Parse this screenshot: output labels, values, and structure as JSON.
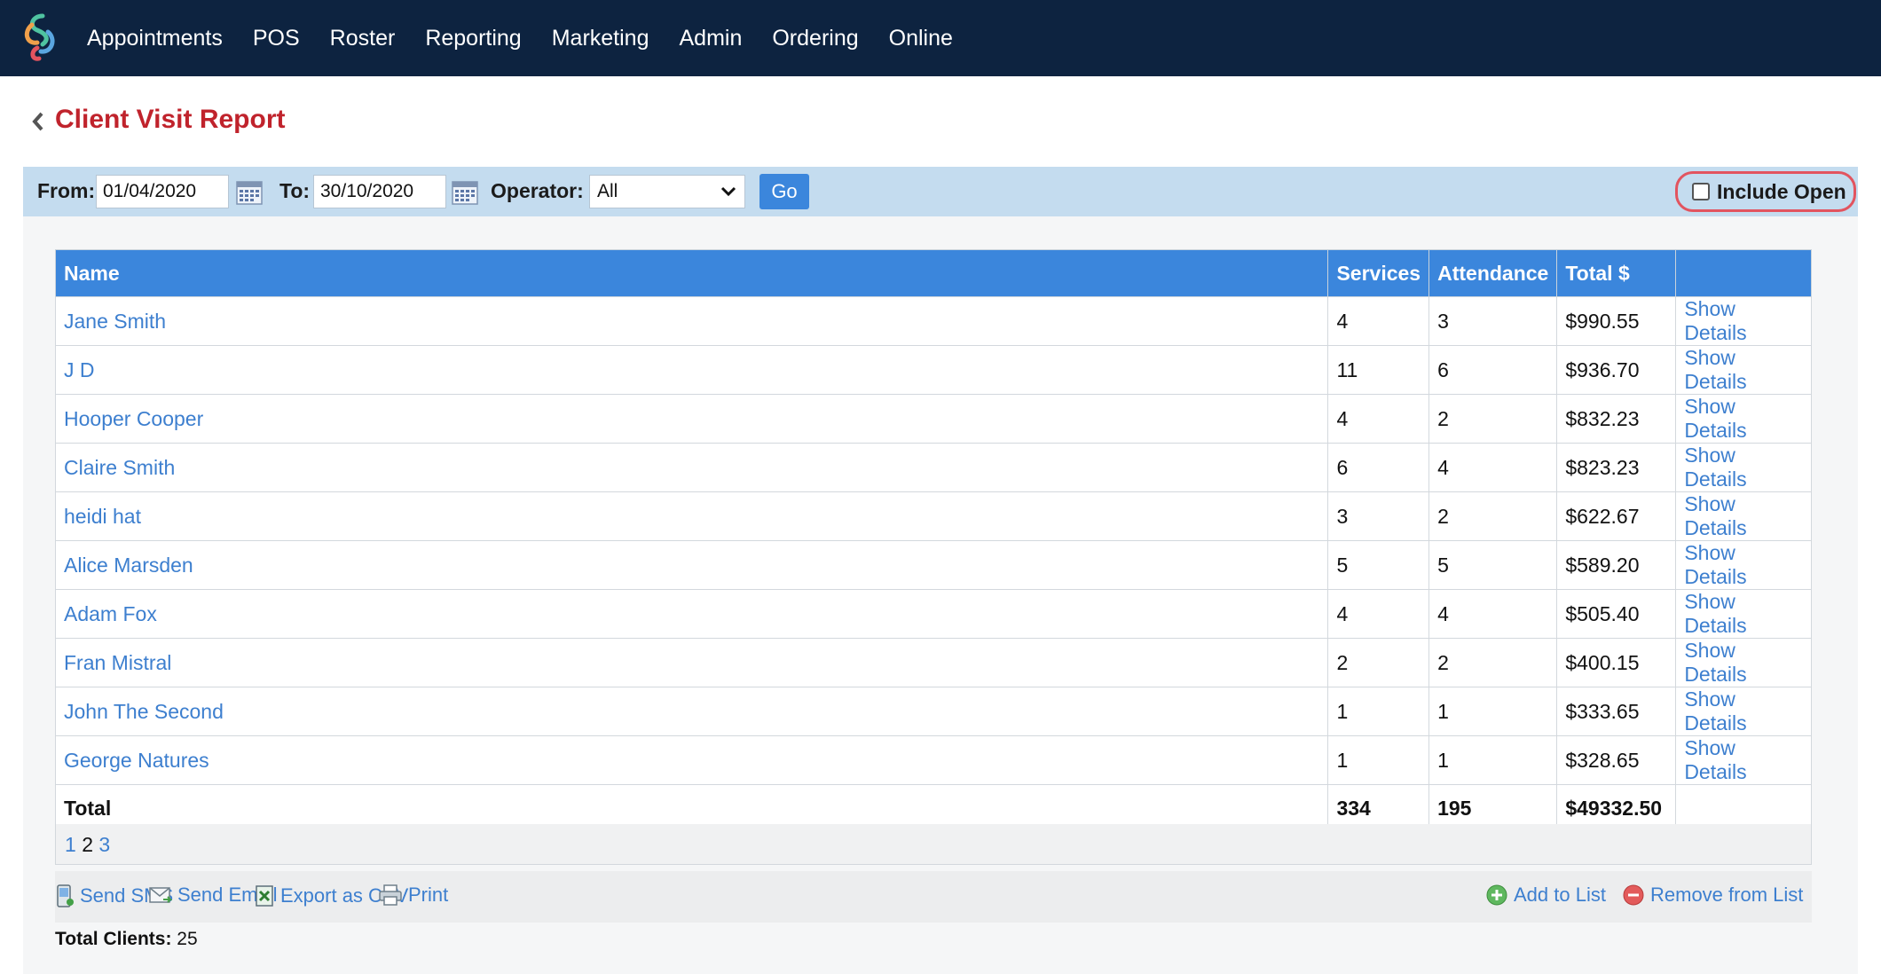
{
  "nav": {
    "items": [
      "Appointments",
      "POS",
      "Roster",
      "Reporting",
      "Marketing",
      "Admin",
      "Ordering",
      "Online"
    ]
  },
  "page": {
    "title": "Client Visit Report"
  },
  "filters": {
    "from_label": "From:",
    "from_value": "01/04/2020",
    "to_label": "To:",
    "to_value": "30/10/2020",
    "operator_label": "Operator:",
    "operator_value": "All",
    "go_label": "Go",
    "include_open_label": "Include Open",
    "include_open_checked": false
  },
  "table": {
    "headers": [
      "Name",
      "Services",
      "Attendance",
      "Total $",
      ""
    ],
    "details_label": "Show Details",
    "rows": [
      {
        "name": "Jane Smith",
        "services": "4",
        "attendance": "3",
        "total": "$990.55"
      },
      {
        "name": "J D",
        "services": "11",
        "attendance": "6",
        "total": "$936.70"
      },
      {
        "name": "Hooper Cooper",
        "services": "4",
        "attendance": "2",
        "total": "$832.23"
      },
      {
        "name": "Claire Smith",
        "services": "6",
        "attendance": "4",
        "total": "$823.23"
      },
      {
        "name": "heidi hat",
        "services": "3",
        "attendance": "2",
        "total": "$622.67"
      },
      {
        "name": "Alice Marsden",
        "services": "5",
        "attendance": "5",
        "total": "$589.20"
      },
      {
        "name": "Adam Fox",
        "services": "4",
        "attendance": "4",
        "total": "$505.40"
      },
      {
        "name": "Fran Mistral",
        "services": "2",
        "attendance": "2",
        "total": "$400.15"
      },
      {
        "name": "John The Second",
        "services": "1",
        "attendance": "1",
        "total": "$333.65"
      },
      {
        "name": "George Natures",
        "services": "1",
        "attendance": "1",
        "total": "$328.65"
      }
    ],
    "total_row": {
      "label": "Total",
      "services": "334",
      "attendance": "195",
      "total": "$49332.50"
    }
  },
  "pagination": {
    "pages": [
      "1",
      "2",
      "3"
    ],
    "current": "2"
  },
  "actions": {
    "send_sms": "Send SMS",
    "send_email": "Send Email",
    "export_csv": "Export as CSV",
    "print": "Print",
    "add_to_list": "Add to List",
    "remove_from_list": "Remove from List"
  },
  "summary": {
    "total_clients_label": "Total Clients:",
    "total_clients_value": "25"
  },
  "colors": {
    "nav_bg": "#0d2340",
    "title": "#c0232c",
    "filter_bg": "#c4dcef",
    "table_header": "#3b86dc",
    "link": "#3d7fcf",
    "highlight": "#e2545f"
  }
}
